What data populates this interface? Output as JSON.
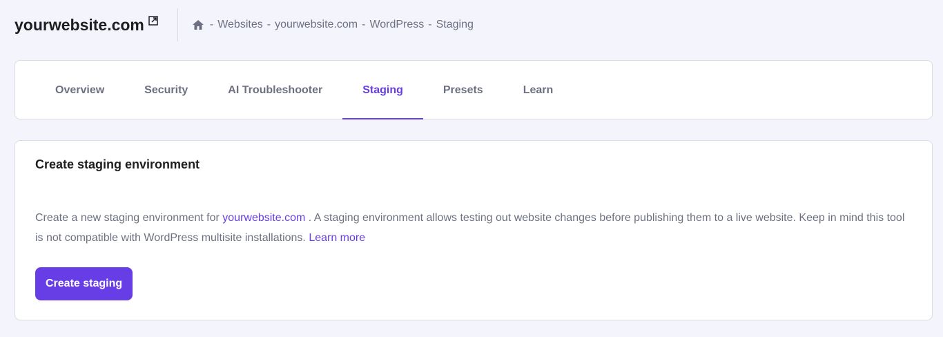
{
  "header": {
    "site": "yourwebsite.com",
    "breadcrumb": [
      "Websites",
      "yourwebsite.com",
      "WordPress",
      "Staging"
    ],
    "separator": "-"
  },
  "tabs": [
    {
      "label": "Overview"
    },
    {
      "label": "Security"
    },
    {
      "label": "AI Troubleshooter"
    },
    {
      "label": "Staging",
      "active": true
    },
    {
      "label": "Presets"
    },
    {
      "label": "Learn"
    }
  ],
  "card": {
    "title": "Create staging environment",
    "text_before": "Create a new staging environment for ",
    "link_site": "yourwebsite.com",
    "text_after": " . A staging environment allows testing out website changes before publishing them to a live website. Keep in mind this tool is not compatible with WordPress multisite installations. ",
    "learn_more": "Learn more",
    "button": "Create staging"
  },
  "colors": {
    "accent": "#673de6",
    "background": "#f4f4fd"
  }
}
